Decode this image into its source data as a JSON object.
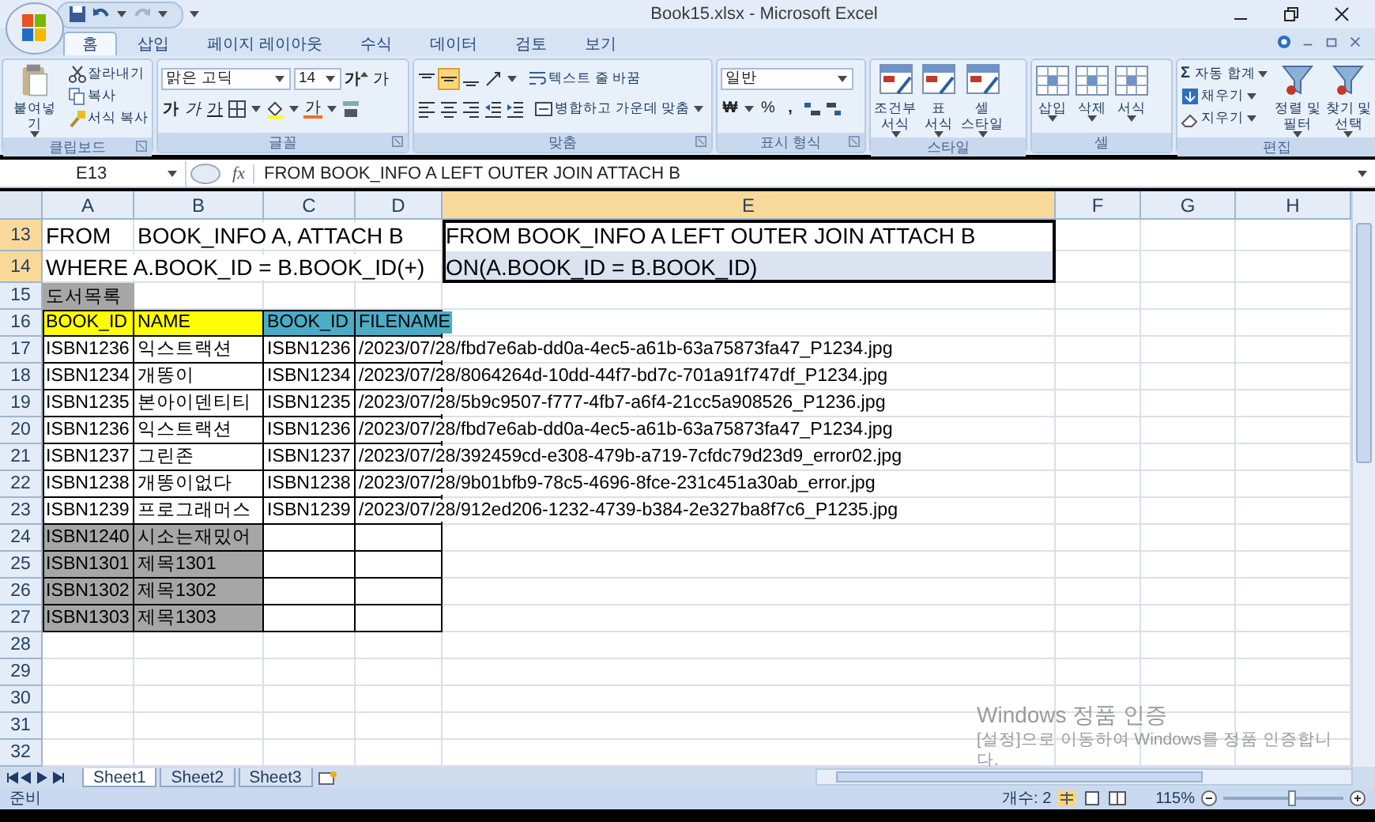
{
  "window": {
    "title": "Book15.xlsx - Microsoft Excel"
  },
  "ribbon_tabs": [
    {
      "label": "홈",
      "selected": true
    },
    {
      "label": "삽입",
      "selected": false
    },
    {
      "label": "페이지 레이아웃",
      "selected": false
    },
    {
      "label": "수식",
      "selected": false
    },
    {
      "label": "데이터",
      "selected": false
    },
    {
      "label": "검토",
      "selected": false
    },
    {
      "label": "보기",
      "selected": false
    }
  ],
  "clipboard": {
    "label": "클립보드",
    "paste": "붙여넣기",
    "cut": "잘라내기",
    "copy": "복사",
    "format_painter": "서식 복사"
  },
  "font": {
    "label": "글꼴",
    "name": "맑은 고딕",
    "size": "14",
    "grow": "가",
    "shrink": "가",
    "bold": "가",
    "italic": "가",
    "underline": "가",
    "font_color": "가"
  },
  "alignment": {
    "label": "맞춤",
    "wrap": "텍스트 줄 바꿈",
    "merge": "병합하고 가운데 맞춤"
  },
  "number": {
    "label": "표시 형식",
    "format": "일반",
    "currency": "₩",
    "percent": "%",
    "comma": ","
  },
  "styles": {
    "label": "스타일",
    "buttons": [
      {
        "lines": [
          "조건부",
          "서식"
        ]
      },
      {
        "lines": [
          "표",
          "서식"
        ]
      },
      {
        "lines": [
          "셀",
          "스타일"
        ]
      }
    ]
  },
  "cells_group": {
    "label": "셀",
    "buttons": [
      {
        "lines": [
          "삽입"
        ]
      },
      {
        "lines": [
          "삭제"
        ]
      },
      {
        "lines": [
          "서식"
        ]
      }
    ]
  },
  "editing": {
    "label": "편집",
    "autosum_symbol": "Σ",
    "autosum": "자동 합계",
    "fill": "채우기",
    "clear": "지우기",
    "buttons": [
      {
        "lines": [
          "정렬 및",
          "필터"
        ]
      },
      {
        "lines": [
          "찾기 및",
          "선택"
        ]
      }
    ]
  },
  "formula_bar": {
    "name_box": "E13",
    "fx": "fx",
    "formula": "FROM BOOK_INFO A LEFT OUTER JOIN ATTACH B"
  },
  "sheet": {
    "columns": [
      {
        "label": "A",
        "selected": false
      },
      {
        "label": "B",
        "selected": false
      },
      {
        "label": "C",
        "selected": false
      },
      {
        "label": "D",
        "selected": false
      },
      {
        "label": "E",
        "selected": true
      },
      {
        "label": "F",
        "selected": false
      },
      {
        "label": "G",
        "selected": false
      },
      {
        "label": "H",
        "selected": false
      }
    ],
    "rows": [
      {
        "number": "13",
        "kind": "tall",
        "selected": true,
        "cells": [
          {
            "text": "FROM",
            "boxed": false
          },
          {
            "text": "BOOK_INFO A, ATTACH B",
            "boxed": false
          },
          {
            "boxed": false
          },
          {
            "boxed": false
          },
          {
            "text": "FROM BOOK_INFO A LEFT OUTER JOIN ATTACH B",
            "boxed": false
          }
        ]
      },
      {
        "number": "14",
        "kind": "tall",
        "selected": true,
        "cells": [
          {
            "text": "WHERE A.BOOK_ID = B.BOOK_ID(+)",
            "boxed": false
          },
          {
            "boxed": false
          },
          {
            "boxed": false
          },
          {
            "boxed": false
          },
          {
            "text": "ON(A.BOOK_ID = B.BOOK_ID)",
            "boxed": false
          }
        ]
      },
      {
        "number": "15",
        "kind": "normal",
        "selected": false,
        "cells": [
          {
            "text": "도서목록",
            "color": "#a6a6a6",
            "boxed": false
          }
        ]
      },
      {
        "number": "16",
        "kind": "normal",
        "selected": false,
        "cells": [
          {
            "text": "BOOK_ID",
            "color": "#ffff00",
            "boxed": true
          },
          {
            "text": "NAME",
            "color": "#ffff00",
            "boxed": true
          },
          {
            "text": "BOOK_ID",
            "color": "#4bacc6",
            "boxed": true
          },
          {
            "text": "FILENAME",
            "color": "#4bacc6",
            "boxed": true
          }
        ]
      },
      {
        "number": "17",
        "kind": "normal",
        "selected": false,
        "cells": [
          {
            "text": "ISBN1236",
            "boxed": true
          },
          {
            "text": "익스트랙션",
            "boxed": true
          },
          {
            "text": "ISBN1236",
            "boxed": true
          },
          {
            "text": "/2023/07/28/fbd7e6ab-dd0a-4ec5-a61b-63a75873fa47_P1234.jpg",
            "boxed": true
          }
        ]
      },
      {
        "number": "18",
        "kind": "normal",
        "selected": false,
        "cells": [
          {
            "text": "ISBN1234",
            "boxed": true
          },
          {
            "text": "개똥이",
            "boxed": true
          },
          {
            "text": "ISBN1234",
            "boxed": true
          },
          {
            "text": "/2023/07/28/8064264d-10dd-44f7-bd7c-701a91f747df_P1234.jpg",
            "boxed": true
          }
        ]
      },
      {
        "number": "19",
        "kind": "normal",
        "selected": false,
        "cells": [
          {
            "text": "ISBN1235",
            "boxed": true
          },
          {
            "text": "본아이덴티티",
            "boxed": true
          },
          {
            "text": "ISBN1235",
            "boxed": true
          },
          {
            "text": "/2023/07/28/5b9c9507-f777-4fb7-a6f4-21cc5a908526_P1236.jpg",
            "boxed": true
          }
        ]
      },
      {
        "number": "20",
        "kind": "normal",
        "selected": false,
        "cells": [
          {
            "text": "ISBN1236",
            "boxed": true
          },
          {
            "text": "익스트랙션",
            "boxed": true
          },
          {
            "text": "ISBN1236",
            "boxed": true
          },
          {
            "text": "/2023/07/28/fbd7e6ab-dd0a-4ec5-a61b-63a75873fa47_P1234.jpg",
            "boxed": true
          }
        ]
      },
      {
        "number": "21",
        "kind": "normal",
        "selected": false,
        "cells": [
          {
            "text": "ISBN1237",
            "boxed": true
          },
          {
            "text": "그린존",
            "boxed": true
          },
          {
            "text": "ISBN1237",
            "boxed": true
          },
          {
            "text": "/2023/07/28/392459cd-e308-479b-a719-7cfdc79d23d9_error02.jpg",
            "boxed": true
          }
        ]
      },
      {
        "number": "22",
        "kind": "normal",
        "selected": false,
        "cells": [
          {
            "text": "ISBN1238",
            "boxed": true
          },
          {
            "text": "개똥이없다",
            "boxed": true
          },
          {
            "text": "ISBN1238",
            "boxed": true
          },
          {
            "text": "/2023/07/28/9b01bfb9-78c5-4696-8fce-231c451a30ab_error.jpg",
            "boxed": true
          }
        ]
      },
      {
        "number": "23",
        "kind": "normal",
        "selected": false,
        "cells": [
          {
            "text": "ISBN1239",
            "boxed": true
          },
          {
            "text": "프로그래머스",
            "boxed": true
          },
          {
            "text": "ISBN1239",
            "boxed": true
          },
          {
            "text": "/2023/07/28/912ed206-1232-4739-b384-2e327ba8f7c6_P1235.jpg",
            "boxed": true
          }
        ]
      },
      {
        "number": "24",
        "kind": "normal",
        "selected": false,
        "cells": [
          {
            "text": "ISBN1240",
            "color": "#a6a6a6",
            "boxed": true
          },
          {
            "text": "시소는재밌어",
            "color": "#a6a6a6",
            "boxed": true
          },
          {
            "boxed": true
          },
          {
            "boxed": true
          }
        ]
      },
      {
        "number": "25",
        "kind": "normal",
        "selected": false,
        "cells": [
          {
            "text": "ISBN1301",
            "color": "#a6a6a6",
            "boxed": true
          },
          {
            "text": "제목1301",
            "color": "#a6a6a6",
            "boxed": true
          },
          {
            "boxed": true
          },
          {
            "boxed": true
          }
        ]
      },
      {
        "number": "26",
        "kind": "normal",
        "selected": false,
        "cells": [
          {
            "text": "ISBN1302",
            "color": "#a6a6a6",
            "boxed": true
          },
          {
            "text": "제목1302",
            "color": "#a6a6a6",
            "boxed": true
          },
          {
            "boxed": true
          },
          {
            "boxed": true
          }
        ]
      },
      {
        "number": "27",
        "kind": "normal",
        "selected": false,
        "cells": [
          {
            "text": "ISBN1303",
            "color": "#a6a6a6",
            "boxed": true
          },
          {
            "text": "제목1303",
            "color": "#a6a6a6",
            "boxed": true
          },
          {
            "boxed": true
          },
          {
            "boxed": true
          }
        ]
      },
      {
        "number": "28",
        "kind": "normal",
        "selected": false
      },
      {
        "number": "29",
        "kind": "normal",
        "selected": false
      },
      {
        "number": "30",
        "kind": "normal",
        "selected": false
      },
      {
        "number": "31",
        "kind": "normal",
        "selected": false
      },
      {
        "number": "32",
        "kind": "normal",
        "selected": false
      }
    ]
  },
  "sheet_tabs": [
    {
      "label": "Sheet1",
      "selected": true
    },
    {
      "label": "Sheet2",
      "selected": false
    },
    {
      "label": "Sheet3",
      "selected": false
    }
  ],
  "activation_notice": {
    "title": "Windows 정품 인증",
    "text": "[설정]으로 이동하여 Windows를 정품 인증합니다."
  },
  "status_bar": {
    "mode": "준비",
    "count": "개수: 2",
    "zoom": "115%",
    "zoom_slider": {
      "level": 0.57
    }
  }
}
